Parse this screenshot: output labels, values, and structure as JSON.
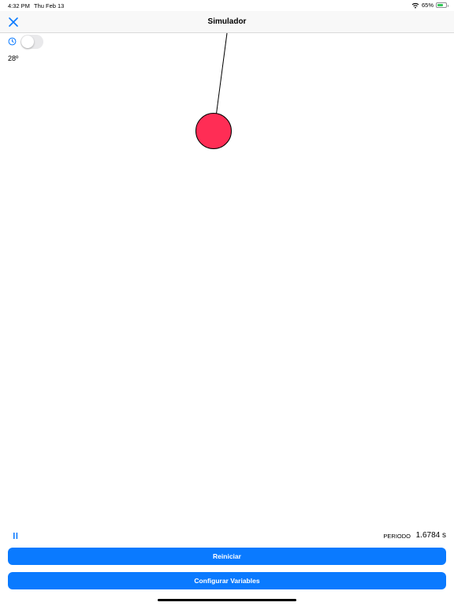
{
  "status_bar": {
    "time": "4:32 PM",
    "date": "Thu Feb 13",
    "battery_percent": "65%",
    "battery_level": 0.65,
    "wifi_icon": "wifi-icon",
    "battery_icon": "battery-charging-icon"
  },
  "nav": {
    "title": "Simulador",
    "close_icon": "close-icon"
  },
  "controls": {
    "timer_icon": "timer-icon",
    "toggle_on": false,
    "angle_label": "28º"
  },
  "pendulum": {
    "bob_color": "#ff2d55"
  },
  "footer": {
    "pause_icon": "pause-icon",
    "period_label": "PERIODO",
    "period_value": "1.6784 s",
    "restart_label": "Reiniciar",
    "configure_label": "Configurar Variables"
  },
  "colors": {
    "accent": "#0a7aff",
    "nav_background": "#f8f8f8"
  }
}
